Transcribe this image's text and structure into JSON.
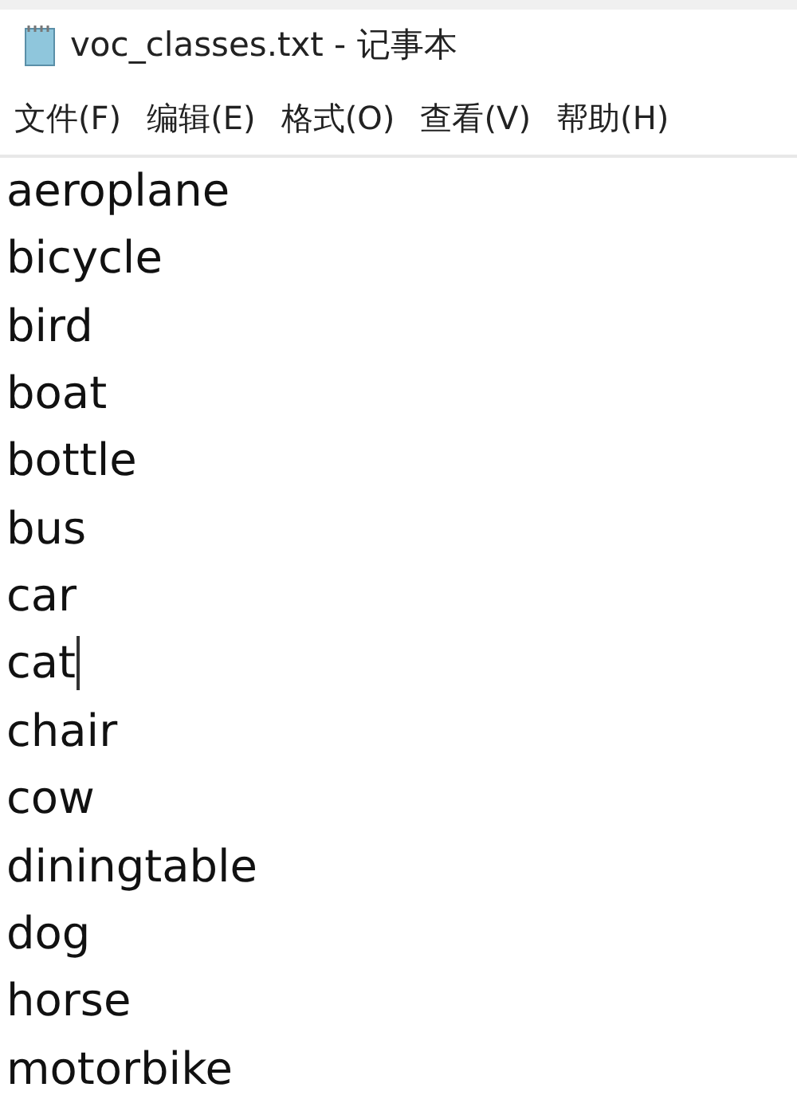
{
  "window": {
    "title": "voc_classes.txt - 记事本"
  },
  "menu": [
    {
      "label": "文件(F)"
    },
    {
      "label": "编辑(E)"
    },
    {
      "label": "格式(O)"
    },
    {
      "label": "查看(V)"
    },
    {
      "label": "帮助(H)"
    }
  ],
  "lines": [
    {
      "text": "aeroplane",
      "caret": false
    },
    {
      "text": "bicycle",
      "caret": false
    },
    {
      "text": "bird",
      "caret": false
    },
    {
      "text": "boat",
      "caret": false
    },
    {
      "text": "bottle",
      "caret": false
    },
    {
      "text": "bus",
      "caret": false
    },
    {
      "text": "car",
      "caret": false
    },
    {
      "text": "cat",
      "caret": true
    },
    {
      "text": "chair",
      "caret": false
    },
    {
      "text": "cow",
      "caret": false
    },
    {
      "text": "diningtable",
      "caret": false
    },
    {
      "text": "dog",
      "caret": false
    },
    {
      "text": "horse",
      "caret": false
    },
    {
      "text": "motorbike",
      "caret": false
    }
  ]
}
